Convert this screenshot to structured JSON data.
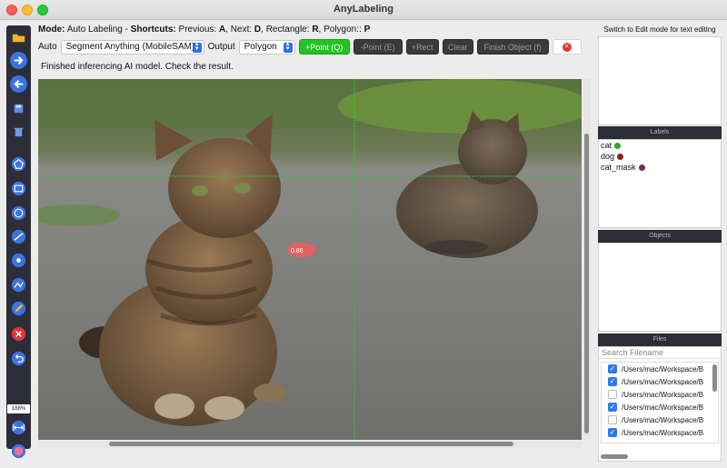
{
  "window": {
    "title": "AnyLabeling"
  },
  "mode_line": {
    "mode_label": "Mode:",
    "mode_value": "Auto Labeling",
    "sep": " - ",
    "shortcuts_label": "Shortcuts:",
    "shortcuts_text_1": " Previous: ",
    "prev_key": "A",
    "shortcuts_text_2": ", Next: ",
    "next_key": "D",
    "shortcuts_text_3": ", Rectangle: ",
    "rect_key": "R",
    "shortcuts_text_4": ", Polygon:: ",
    "poly_key": "P"
  },
  "controls": {
    "auto_label": "Auto",
    "model_value": "Segment Anything (MobileSAM)",
    "output_label": "Output",
    "output_value": "Polygon",
    "point_add": "+Point (Q)",
    "point_remove": "-Point (E)",
    "rect_add": "+Rect",
    "clear": "Clear",
    "finish": "Finish Object (f)",
    "close_symbol": "✕"
  },
  "status_message": "Finished inferencing AI model. Check the result.",
  "toolbar": {
    "icons": [
      "open-folder-icon",
      "next-arrow-icon",
      "prev-arrow-icon",
      "save-icon",
      "delete-icon",
      "polygon-icon",
      "rectangle-icon",
      "circle-icon",
      "line-icon",
      "point-icon",
      "linestrip-icon",
      "edit-icon",
      "remove-icon",
      "undo-icon",
      "fit-width-icon",
      "brain-icon"
    ],
    "zoom": "188%"
  },
  "canvas": {
    "marker_label": "0.86"
  },
  "right_panel": {
    "edit_note": "Switch to Edit mode for text editing",
    "labels_header": "Labels",
    "labels": [
      {
        "name": "cat",
        "color": "#22aa22"
      },
      {
        "name": "dog",
        "color": "#8a1f1f"
      },
      {
        "name": "cat_mask",
        "color": "#7a2a5a"
      }
    ],
    "objects_header": "Objects",
    "files_header": "Files",
    "search_placeholder": "Search Filename",
    "files": [
      {
        "path": "/Users/mac/Workspace/B",
        "checked": true
      },
      {
        "path": "/Users/mac/Workspace/B",
        "checked": true
      },
      {
        "path": "/Users/mac/Workspace/B",
        "checked": false
      },
      {
        "path": "/Users/mac/Workspace/B",
        "checked": true
      },
      {
        "path": "/Users/mac/Workspace/B",
        "checked": false
      },
      {
        "path": "/Users/mac/Workspace/B",
        "checked": true
      }
    ]
  },
  "colors": {
    "accent_green": "#22c322",
    "toolbar_bg": "#2c2d38",
    "accent_blue": "#2f7bea"
  }
}
